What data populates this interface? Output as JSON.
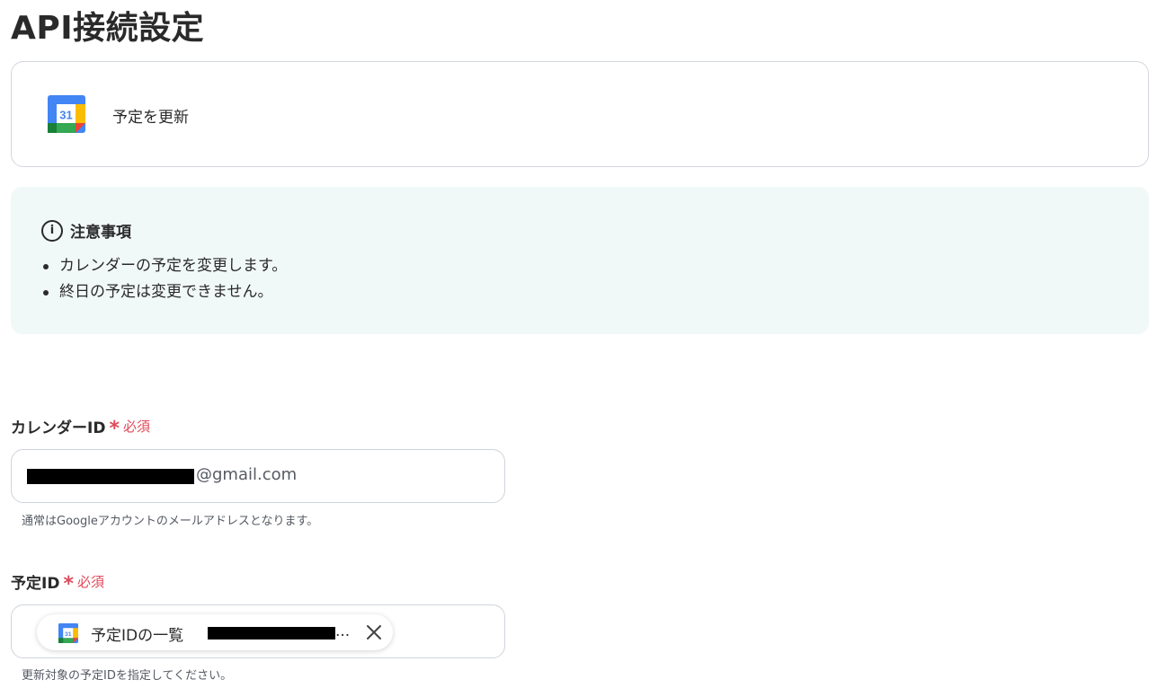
{
  "page": {
    "title": "API接続設定"
  },
  "action": {
    "app_icon": "google-calendar-icon",
    "calendar_day": "31",
    "name": "予定を更新"
  },
  "notice": {
    "icon": "info-icon",
    "title": "注意事項",
    "items": [
      "カレンダーの予定を変更します。",
      "終日の予定は変更できません。"
    ]
  },
  "fields": {
    "calendar_id": {
      "label": "カレンダーID",
      "required_mark": "*",
      "required_text": "必須",
      "value_domain": "@gmail.com",
      "hint": "通常はGoogleアカウントのメールアドレスとなります。"
    },
    "event_id": {
      "label": "予定ID",
      "required_mark": "*",
      "required_text": "必須",
      "chip_icon": "google-calendar-icon",
      "chip_label": "予定IDの一覧",
      "chip_ellipsis": "...",
      "hint": "更新対象の予定IDを指定してください。"
    }
  },
  "colors": {
    "required": "#e04a5a",
    "notice_bg": "#f1f9f8",
    "border": "#cfd4db"
  }
}
